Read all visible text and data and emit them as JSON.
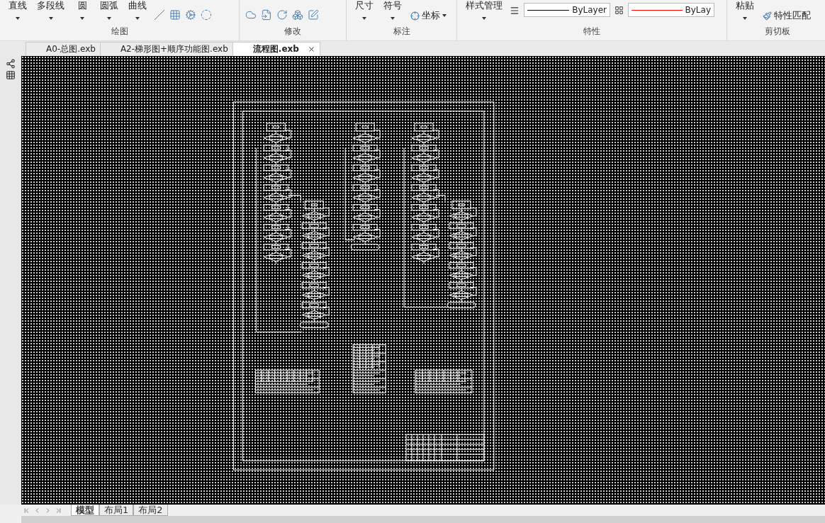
{
  "ribbon": {
    "groups": [
      {
        "kind": "draw",
        "label": "绘图",
        "buttons": [
          "直线",
          "多段线",
          "圆",
          "圆弧",
          "曲线"
        ]
      },
      {
        "kind": "modify",
        "label": "修改"
      },
      {
        "kind": "annotate",
        "label": "标注",
        "buttons": [
          "尺寸",
          "符号"
        ],
        "small_button": "坐标"
      },
      {
        "kind": "properties",
        "label": "特性",
        "buttons": [
          "样式管理"
        ],
        "line_dropdowns": [
          {
            "value": "ByLayer",
            "color": "#000000"
          },
          {
            "value": "ByLay",
            "color": "#ff0000"
          }
        ]
      },
      {
        "kind": "clipboard",
        "label": "剪切板",
        "buttons": [
          "粘贴"
        ],
        "small_button": "特性匹配"
      }
    ]
  },
  "document_tabs": [
    {
      "label": "A0-总图.exb",
      "selected": false
    },
    {
      "label": "A2-梯形图+顺序功能图.exb",
      "selected": false
    },
    {
      "label": "流程图.exb",
      "selected": true
    }
  ],
  "layout_tabs": [
    {
      "label": "模型",
      "selected": true
    },
    {
      "label": "布局1",
      "selected": false
    },
    {
      "label": "布局2",
      "selected": false
    }
  ]
}
